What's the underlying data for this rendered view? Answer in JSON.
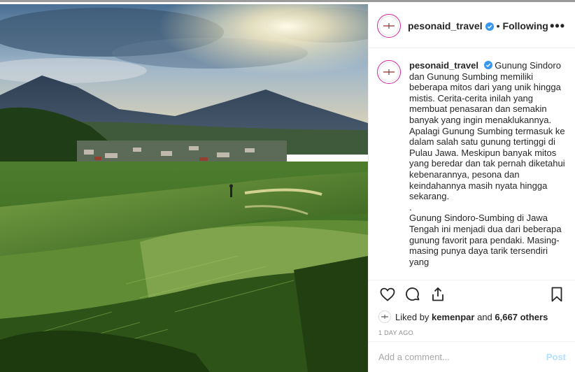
{
  "post": {
    "username": "pesonaid_travel",
    "follow_separator": "•",
    "follow_status": "Following",
    "more_label": "•••"
  },
  "caption": {
    "username": "pesonaid_travel",
    "paragraph1": "Gunung Sindoro dan Gunung Sumbing memiliki beberapa mitos dari yang unik hingga mistis. Cerita-cerita inilah yang membuat penasaran dan semakin banyak yang ingin menaklukannya. Apalagi Gunung Sumbing termasuk ke dalam salah satu gunung tertinggi di Pulau Jawa. Meskipun banyak mitos yang beredar dan tak pernah diketahui kebenarannya, pesona dan keindahannya masih nyata hingga sekarang.",
    "separator": ".",
    "paragraph2": "Gunung Sindoro-Sumbing di Jawa Tengah ini menjadi dua dari beberapa gunung favorit para pendaki. Masing-masing punya daya tarik tersendiri yang"
  },
  "likes": {
    "prefix": "Liked by",
    "user": "kemenpar",
    "connector": "and",
    "count": "6,667 others"
  },
  "timestamp": "1 DAY AGO",
  "comment_box": {
    "placeholder": "Add a comment...",
    "post_label": "Post"
  },
  "icons": {
    "like": "heart-icon",
    "comment": "comment-icon",
    "share": "share-icon",
    "save": "bookmark-icon",
    "verified": "verified-badge-icon"
  },
  "colors": {
    "verified": "#3897f0",
    "post_disabled": "#b2dffc",
    "avatar_ring": "#d6249f"
  }
}
